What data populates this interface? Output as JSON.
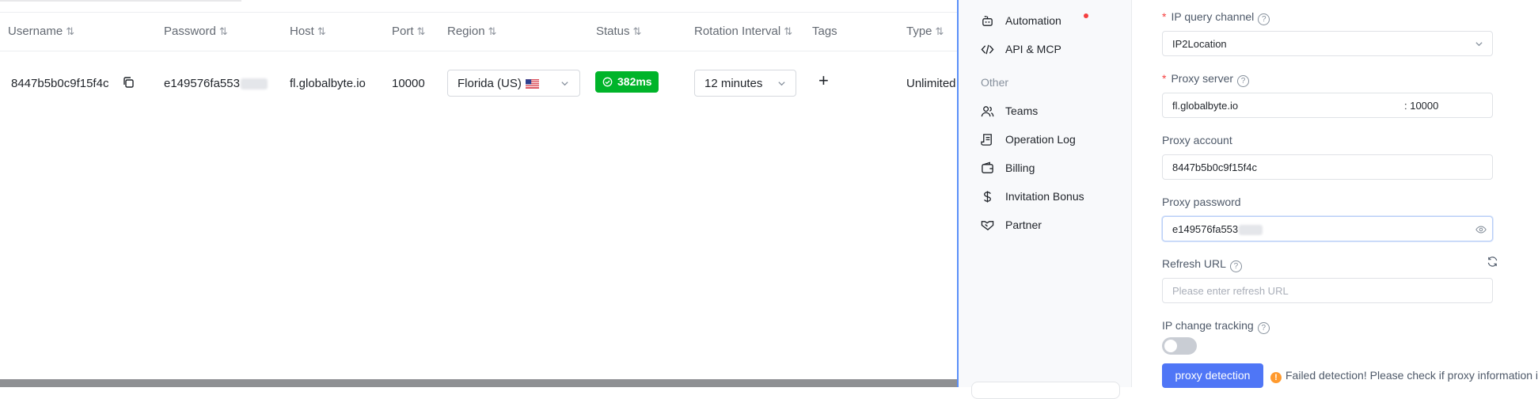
{
  "table": {
    "headers": [
      {
        "label": "Username",
        "sortable": true
      },
      {
        "label": "Password",
        "sortable": true
      },
      {
        "label": "Host",
        "sortable": true
      },
      {
        "label": "Port",
        "sortable": true
      },
      {
        "label": "Region",
        "sortable": true
      },
      {
        "label": "Status",
        "sortable": true
      },
      {
        "label": "Rotation Interval",
        "sortable": true
      },
      {
        "label": "Tags",
        "sortable": false
      },
      {
        "label": "Type",
        "sortable": true
      }
    ],
    "sort_glyph": "⇅",
    "row": {
      "username": "8447b5b0c9f15f4c",
      "password": "e149576fa553",
      "host": "fl.globalbyte.io",
      "port": "10000",
      "region": "Florida (US)",
      "status": "382ms",
      "rotation_interval": "12 minutes",
      "tags_add": "+",
      "type": "Unlimited"
    },
    "status_color": "#00b42a"
  },
  "sidebar": {
    "items_top": [
      {
        "label": "Automation",
        "icon": "robot-icon",
        "badge_dot": true
      },
      {
        "label": "API & MCP",
        "icon": "code-icon"
      }
    ],
    "section_label": "Other",
    "items_other": [
      {
        "label": "Teams",
        "icon": "users-icon"
      },
      {
        "label": "Operation Log",
        "icon": "scroll-icon"
      },
      {
        "label": "Billing",
        "icon": "wallet-icon"
      },
      {
        "label": "Invitation Bonus",
        "icon": "dollar-icon"
      },
      {
        "label": "Partner",
        "icon": "handshake-icon"
      }
    ]
  },
  "form": {
    "ip_query_channel": {
      "label": "IP query channel",
      "value": "IP2Location",
      "required": true
    },
    "proxy_server": {
      "label": "Proxy server",
      "host": "fl.globalbyte.io",
      "port": ": 10000",
      "required": true
    },
    "proxy_account": {
      "label": "Proxy account",
      "value": "8447b5b0c9f15f4c"
    },
    "proxy_password": {
      "label": "Proxy password",
      "value": "e149576fa553"
    },
    "refresh_url": {
      "label": "Refresh URL",
      "placeholder": "Please enter refresh URL"
    },
    "ip_change_tracking": {
      "label": "IP change tracking",
      "enabled": false
    },
    "detect_button": "proxy detection",
    "detect_message": "Failed detection! Please check if proxy information is"
  },
  "colors": {
    "accent": "#4f76f6",
    "warning": "#ff9a2e",
    "required": "#f53f3f"
  }
}
